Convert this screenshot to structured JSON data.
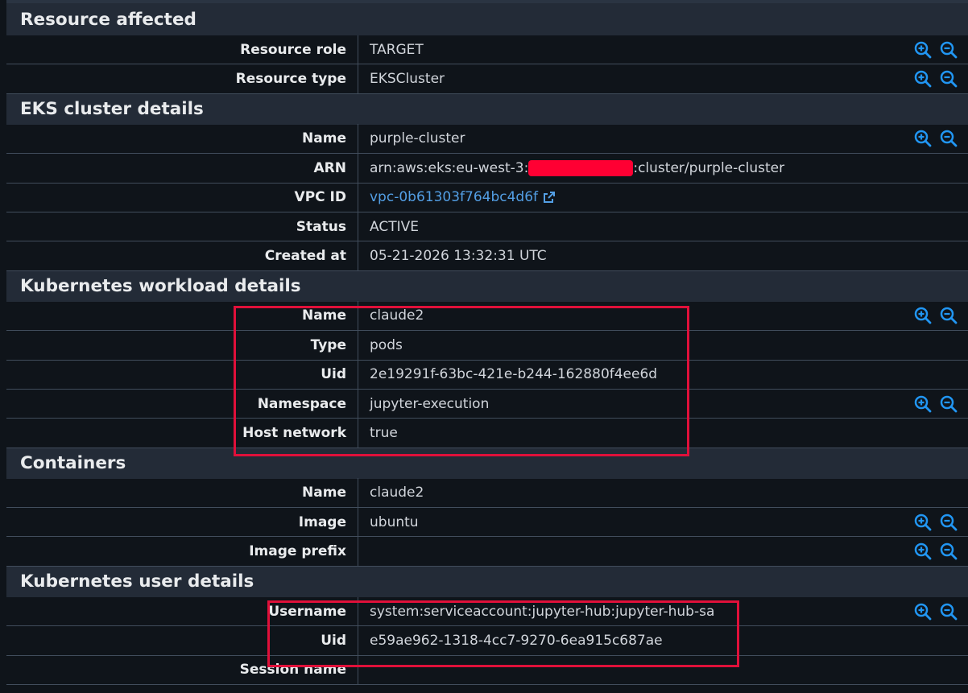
{
  "colors": {
    "background": "#0f141a",
    "header": "#232b37",
    "link": "#539fe5",
    "highlight": "#e0103a",
    "zoom": "#2196f3"
  },
  "sections": [
    {
      "title": "Resource affected",
      "rows": [
        {
          "label": "Resource role",
          "value": "TARGET",
          "zoom": true
        },
        {
          "label": "Resource type",
          "value": "EKSCluster",
          "zoom": true
        }
      ]
    },
    {
      "title": "EKS cluster details",
      "rows": [
        {
          "label": "Name",
          "value": "purple-cluster",
          "zoom": true
        },
        {
          "label": "ARN",
          "value_prefix": "arn:aws:eks:eu-west-3:",
          "value_suffix": ":cluster/purple-cluster",
          "redacted": true
        },
        {
          "label": "VPC ID",
          "value": "vpc-0b61303f764bc4d6f",
          "link": true
        },
        {
          "label": "Status",
          "value": "ACTIVE"
        },
        {
          "label": "Created at",
          "value": "05-21-2026 13:32:31 UTC"
        }
      ]
    },
    {
      "title": "Kubernetes workload details",
      "rows": [
        {
          "label": "Name",
          "value": "claude2",
          "zoom": true
        },
        {
          "label": "Type",
          "value": "pods"
        },
        {
          "label": "Uid",
          "value": "2e19291f-63bc-421e-b244-162880f4ee6d"
        },
        {
          "label": "Namespace",
          "value": "jupyter-execution",
          "zoom": true
        },
        {
          "label": "Host network",
          "value": "true"
        }
      ]
    },
    {
      "title": "Containers",
      "rows": [
        {
          "label": "Name",
          "value": "claude2"
        },
        {
          "label": "Image",
          "value": "ubuntu",
          "zoom": true
        },
        {
          "label": "Image prefix",
          "value": "",
          "zoom": true
        }
      ]
    },
    {
      "title": "Kubernetes user details",
      "rows": [
        {
          "label": "Username",
          "value": "system:serviceaccount:jupyter-hub:jupyter-hub-sa",
          "zoom": true
        },
        {
          "label": "Uid",
          "value": "e59ae962-1318-4cc7-9270-6ea915c687ae"
        },
        {
          "label": "Session name",
          "value": ""
        }
      ]
    }
  ]
}
